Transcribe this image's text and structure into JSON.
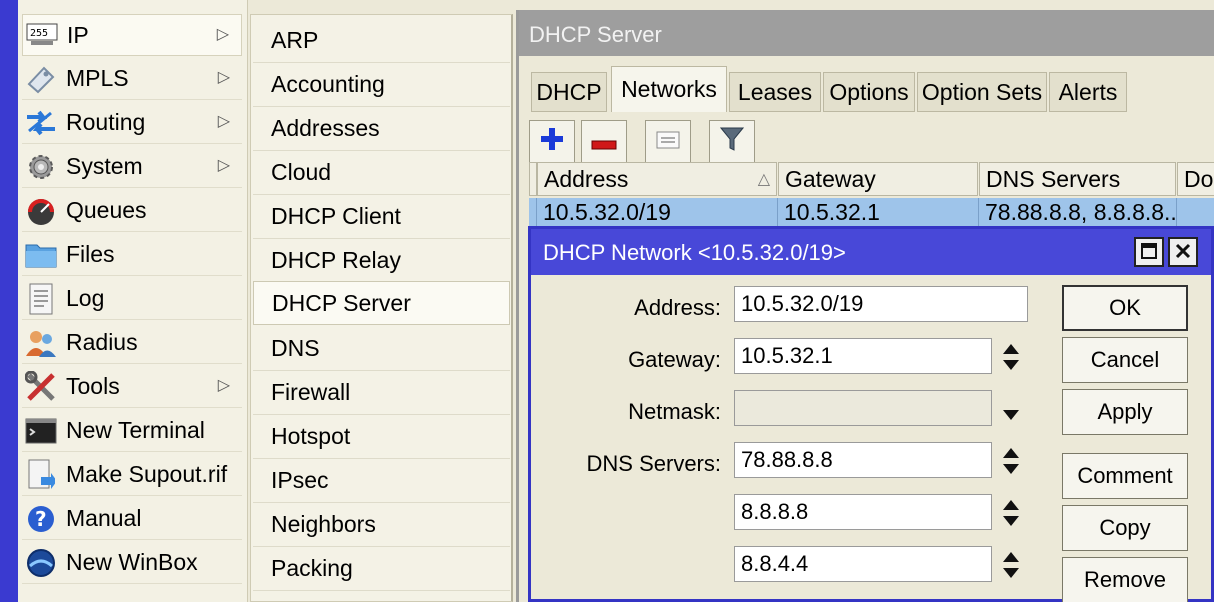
{
  "main_menu": {
    "items": [
      {
        "label": "IP",
        "icon": "ip-icon",
        "has_submenu": true
      },
      {
        "label": "MPLS",
        "icon": "mpls-icon",
        "has_submenu": true
      },
      {
        "label": "Routing",
        "icon": "routing-icon",
        "has_submenu": true
      },
      {
        "label": "System",
        "icon": "gear-icon",
        "has_submenu": true
      },
      {
        "label": "Queues",
        "icon": "queues-icon",
        "has_submenu": false
      },
      {
        "label": "Files",
        "icon": "folder-icon",
        "has_submenu": false
      },
      {
        "label": "Log",
        "icon": "log-icon",
        "has_submenu": false
      },
      {
        "label": "Radius",
        "icon": "radius-icon",
        "has_submenu": false
      },
      {
        "label": "Tools",
        "icon": "tools-icon",
        "has_submenu": true
      },
      {
        "label": "New Terminal",
        "icon": "terminal-icon",
        "has_submenu": false
      },
      {
        "label": "Make Supout.rif",
        "icon": "supout-icon",
        "has_submenu": false
      },
      {
        "label": "Manual",
        "icon": "help-icon",
        "has_submenu": false
      },
      {
        "label": "New WinBox",
        "icon": "winbox-icon",
        "has_submenu": false
      }
    ],
    "ip_badge": "255",
    "submenu_arrow": "▷"
  },
  "ip_submenu": {
    "items": [
      "ARP",
      "Accounting",
      "Addresses",
      "Cloud",
      "DHCP Client",
      "DHCP Relay",
      "DHCP Server",
      "DNS",
      "Firewall",
      "Hotspot",
      "IPsec",
      "Neighbors",
      "Packing"
    ],
    "selected": "DHCP Server"
  },
  "server_window": {
    "title": "DHCP Server",
    "tabs": [
      "DHCP",
      "Networks",
      "Leases",
      "Options",
      "Option Sets",
      "Alerts"
    ],
    "active_tab": "Networks",
    "toolbar": [
      "add-icon",
      "remove-icon",
      "comment-icon",
      "filter-icon"
    ],
    "table": {
      "columns": [
        "Address",
        "Gateway",
        "DNS Servers",
        "Dor"
      ],
      "sort_indicator": "△",
      "rows": [
        {
          "address": "10.5.32.0/19",
          "gateway": "10.5.32.1",
          "dns": "78.88.8.8, 8.8.8.8...",
          "domain": ""
        }
      ]
    }
  },
  "dialog": {
    "title": "DHCP Network <10.5.32.0/19>",
    "fields": {
      "address_label": "Address:",
      "address_value": "10.5.32.0/19",
      "gateway_label": "Gateway:",
      "gateway_value": "10.5.32.1",
      "netmask_label": "Netmask:",
      "netmask_value": "",
      "dns_label": "DNS Servers:",
      "dns_values": [
        "78.88.8.8",
        "8.8.8.8",
        "8.8.4.4"
      ]
    },
    "buttons": [
      "OK",
      "Cancel",
      "Apply",
      "Comment",
      "Copy",
      "Remove"
    ]
  },
  "colors": {
    "selection": "#9ec4ea",
    "dialog_title": "#4848d8",
    "window_title_inactive": "#9e9e9e",
    "add_icon": "#1a3ad8",
    "remove_icon": "#d01818"
  }
}
